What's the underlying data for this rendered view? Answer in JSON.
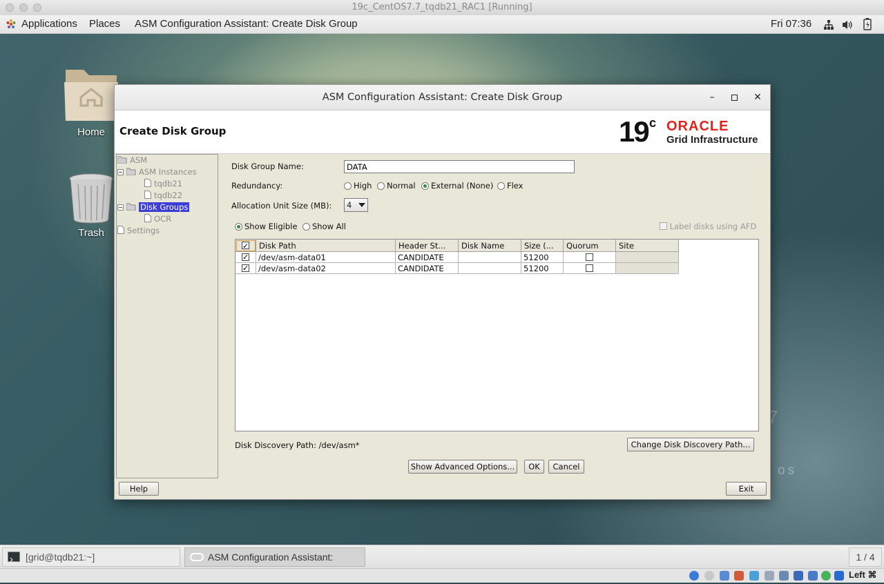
{
  "host_window": {
    "title": "19c_CentOS7.7_tqdb21_RAC1 [Running]"
  },
  "gnome_panel": {
    "applications": "Applications",
    "places": "Places",
    "active_app": "ASM Configuration Assistant: Create Disk Group",
    "clock": "Fri 07:36"
  },
  "desktop": {
    "icons": [
      {
        "label": "Home"
      },
      {
        "label": "Trash"
      }
    ],
    "watermark_fragment": "7",
    "watermark_os": "os"
  },
  "dialog": {
    "title": "ASM Configuration Assistant: Create Disk Group",
    "header_title": "Create Disk Group",
    "logo": {
      "version": "19",
      "suffix": "c",
      "brand": "ORACLE",
      "product": "Grid Infrastructure",
      "brand_color": "#e2231a"
    },
    "tree": {
      "root": "ASM",
      "asm_instances": "ASM Instances",
      "instances": [
        "tqdb21",
        "tqdb22"
      ],
      "disk_groups": "Disk Groups",
      "groups": [
        "OCR"
      ],
      "settings": "Settings"
    },
    "form": {
      "dg_name_label": "Disk Group Name:",
      "dg_name_value": "DATA",
      "redundancy_label": "Redundancy:",
      "redundancy_options": [
        "High",
        "Normal",
        "External (None)",
        "Flex"
      ],
      "redundancy_selected": "External (None)",
      "au_label": "Allocation Unit Size (MB):",
      "au_value": "4",
      "show_eligible": "Show Eligible",
      "show_all": "Show All",
      "label_afd": "Label disks using AFD"
    },
    "table": {
      "columns": [
        "Disk Path",
        "Header St...",
        "Disk Name",
        "Size (...",
        "Quorum",
        "Site"
      ],
      "rows": [
        {
          "checked": true,
          "path": "/dev/asm-data01",
          "header_status": "CANDIDATE",
          "disk_name": "",
          "size": "51200",
          "quorum": false,
          "site": ""
        },
        {
          "checked": true,
          "path": "/dev/asm-data02",
          "header_status": "CANDIDATE",
          "disk_name": "",
          "size": "51200",
          "quorum": false,
          "site": ""
        }
      ]
    },
    "discovery": {
      "label": "Disk Discovery Path: /dev/asm*",
      "change_button": "Change Disk Discovery Path..."
    },
    "buttons": {
      "advanced": "Show Advanced Options...",
      "ok": "OK",
      "cancel": "Cancel",
      "help": "Help",
      "exit": "Exit"
    },
    "selection_color": "#3c3cd8"
  },
  "taskbar": {
    "terminal": "[grid@tqdb21:~]",
    "active_window": "ASM Configuration Assistant: Create...",
    "workspace": "1 / 4"
  },
  "host_statusbar": {
    "hostkey": "Left ⌘"
  }
}
